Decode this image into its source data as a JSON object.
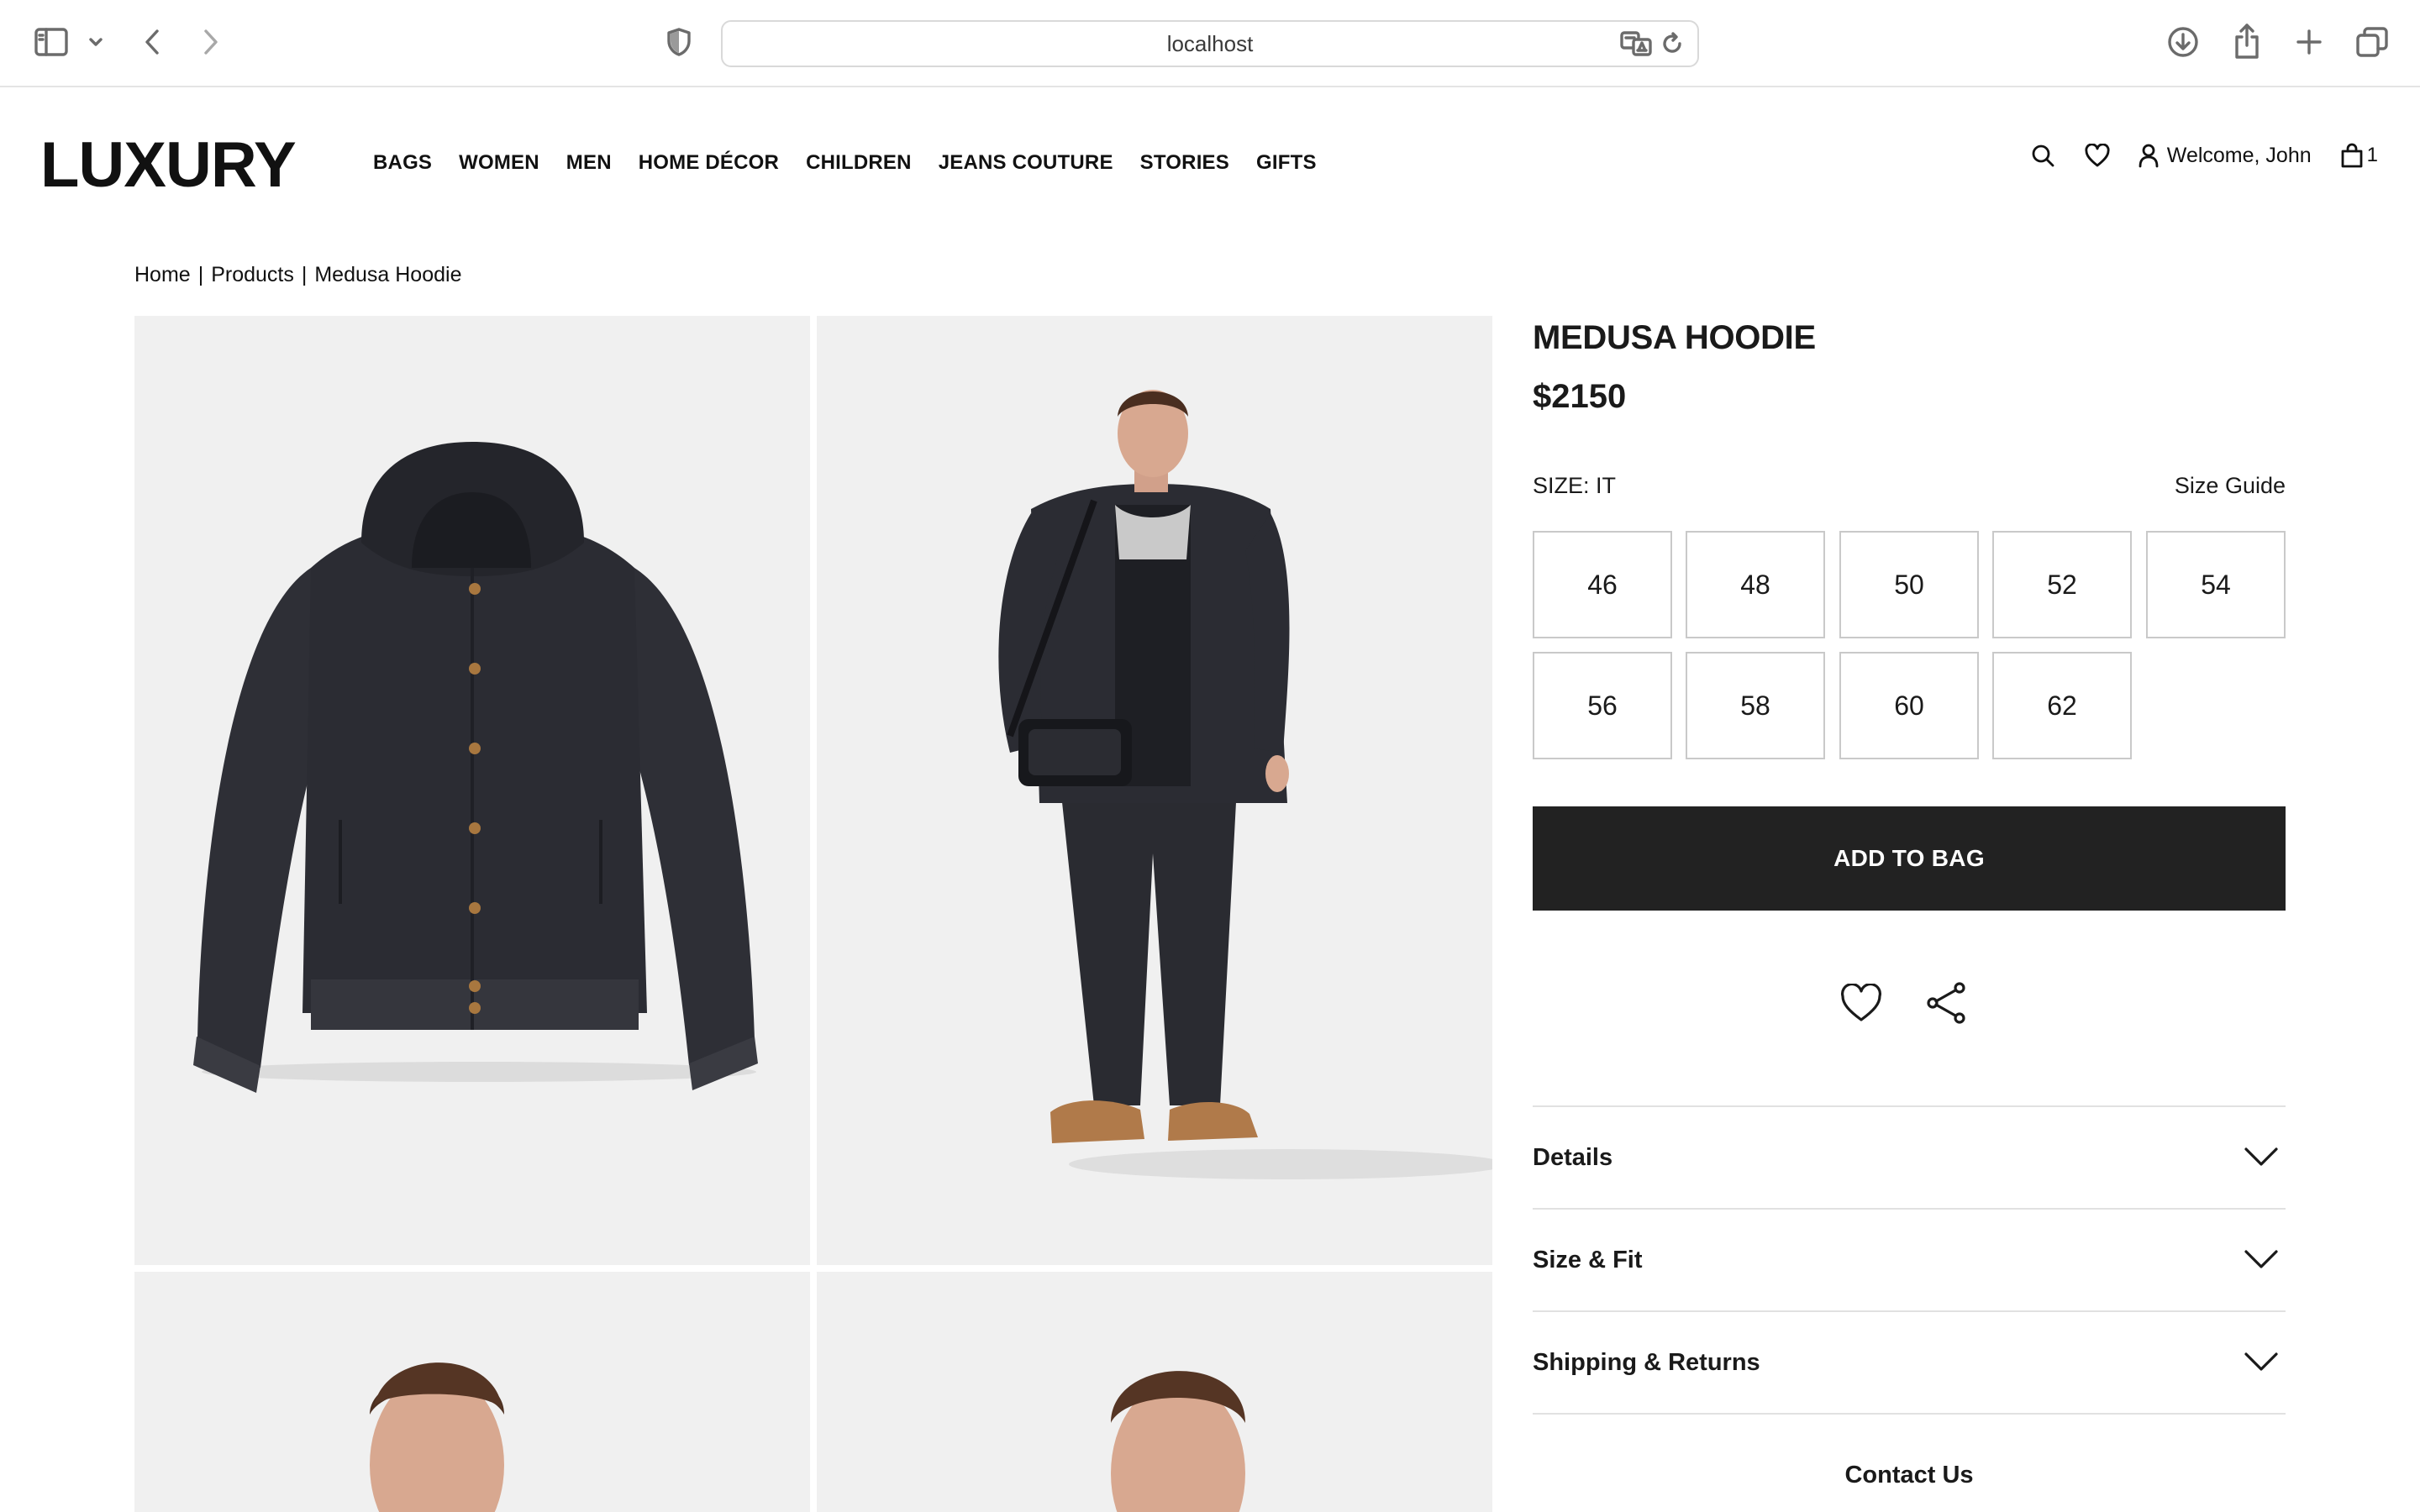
{
  "browser": {
    "url": "localhost"
  },
  "site": {
    "logo": "LUXURY",
    "nav": [
      "BAGS",
      "WOMEN",
      "MEN",
      "HOME DÉCOR",
      "CHILDREN",
      "JEANS COUTURE",
      "STORIES",
      "GIFTS"
    ],
    "welcome": "Welcome, John",
    "bag_count": "1"
  },
  "breadcrumb": {
    "items": [
      "Home",
      "Products",
      "Medusa Hoodie"
    ],
    "separator": "|"
  },
  "product": {
    "title": "MEDUSA HOODIE",
    "price": "$2150",
    "size_label": "SIZE: IT",
    "size_guide": "Size Guide",
    "sizes": [
      "46",
      "48",
      "50",
      "52",
      "54",
      "56",
      "58",
      "60",
      "62"
    ],
    "add_to_bag": "ADD TO BAG",
    "accordion": [
      "Details",
      "Size & Fit",
      "Shipping & Returns"
    ],
    "contact": "Contact Us"
  },
  "colors": {
    "button_bg": "#222222",
    "tile_bg": "#f0f0f0",
    "garment": "#2b2c33"
  }
}
